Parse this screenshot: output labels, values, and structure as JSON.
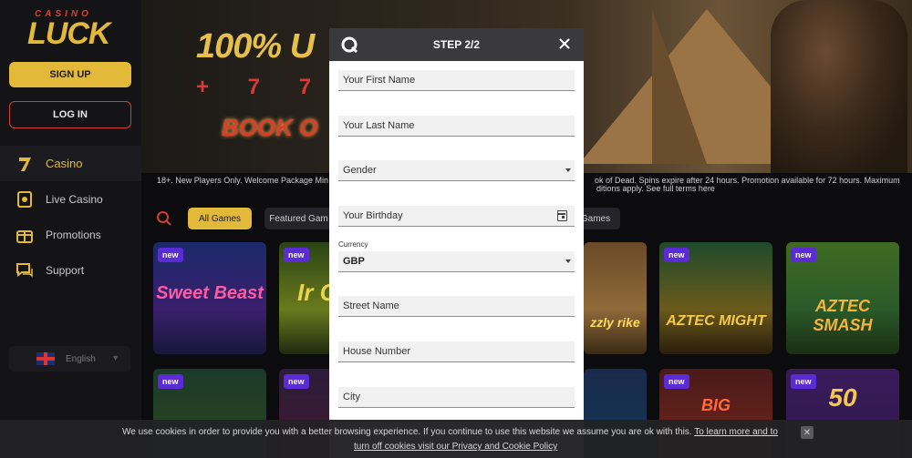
{
  "brand": {
    "logo_top": "CASINO",
    "logo_main": "LUCK"
  },
  "sidebar": {
    "signup_label": "SIGN UP",
    "login_label": "LOG IN",
    "items": [
      {
        "label": "Casino",
        "icon": "seven-icon"
      },
      {
        "label": "Live Casino",
        "icon": "live-casino-icon"
      },
      {
        "label": "Promotions",
        "icon": "gift-icon"
      },
      {
        "label": "Support",
        "icon": "chat-icon"
      }
    ],
    "language": "English"
  },
  "banner": {
    "headline": "100% U",
    "subline": "+ 7 7   S",
    "book_text": "BOOK O",
    "terms_left": "18+. New Players Only. Welcome Package Min",
    "terms_right_1": "ok of Dead. Spins expire after 24 hours. Promotion available for 72 hours. Maximum",
    "terms_right_2": "ditions apply.  See full terms here"
  },
  "filters": {
    "all": "All Games",
    "featured": "Featured Gam",
    "other": "Games"
  },
  "tiles": [
    {
      "badge": "new",
      "title": "Sweet Beast"
    },
    {
      "badge": "new",
      "title": "Ir Cr"
    },
    {
      "badge": "",
      "title": "zzly rike"
    },
    {
      "badge": "new",
      "title": "AZTEC MIGHT"
    },
    {
      "badge": "new",
      "title": "AZTEC SMASH"
    },
    {
      "badge": "new",
      "title": ""
    },
    {
      "badge": "new",
      "title": ""
    },
    {
      "badge": "",
      "title": ""
    },
    {
      "badge": "new",
      "title": "BIG"
    },
    {
      "badge": "new",
      "title": "50"
    }
  ],
  "modal": {
    "title": "STEP 2/2",
    "first_name": "Your First Name",
    "last_name": "Your Last Name",
    "gender": "Gender",
    "birthday": "Your Birthday",
    "currency_label": "Currency",
    "currency_value": "GBP",
    "street": "Street Name",
    "house": "House Number",
    "city": "City"
  },
  "cookie": {
    "text": "We use cookies in order to provide you with a better browsing experience. If you continue to use this website we assume you are ok with this. ",
    "link1": "To learn more and to",
    "link2": "turn off cookies visit our Privacy and Cookie Policy",
    "close": "✕"
  },
  "colors": {
    "accent": "#e3b93a",
    "danger": "#d63a3a",
    "new_badge": "#5b2bd6"
  }
}
